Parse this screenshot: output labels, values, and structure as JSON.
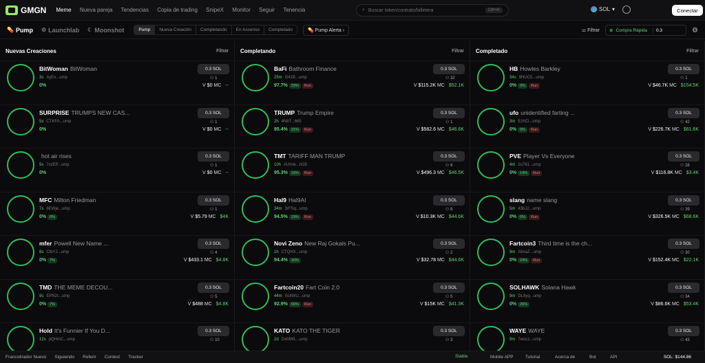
{
  "header": {
    "logo": "GMGN",
    "nav": [
      "Meme",
      "Nueva pareja",
      "Tendencias",
      "Copia de trading",
      "SnipeX",
      "Monitor",
      "Seguir",
      "Tenencia"
    ],
    "search_placeholder": "Buscar token/contrato/billetera",
    "search_kbd": "Ctrl+K",
    "chain": "SOL",
    "connect": "Conectar"
  },
  "subbar": {
    "tabs": [
      "Pump",
      "Launchlab",
      "Moonshot"
    ],
    "segments": [
      "Pump",
      "Nueva Creación",
      "Completando",
      "En Ascenso",
      "Completado"
    ],
    "pump_alert": "Pump Alerta",
    "filtrar": "Filtrar",
    "quick_buy": "Compra Rápida",
    "quick_val": "0.3"
  },
  "columns": [
    {
      "title": "Nuevas Creaciones",
      "filter": "Filtrar",
      "items": [
        {
          "sym": "BitWoman",
          "name": "BitWoman",
          "age": "3s",
          "addr": "AyEx...ump",
          "h1": "1",
          "pct": "0%",
          "v": "$0",
          "mc": "--"
        },
        {
          "sym": "SURPRISE",
          "name": "TRUMPS NEW CAS...",
          "age": "5s",
          "addr": "CTKFA...ump",
          "h1": "1",
          "pct": "0%",
          "v": "$0",
          "mc": "--"
        },
        {
          "sym": "",
          "name": "hot air rises",
          "age": "5s",
          "addr": "7vzEP...ump",
          "h1": "1",
          "pct": "0%",
          "v": "$0",
          "mc": "--"
        },
        {
          "sym": "MFC",
          "name": "Milton Friedman",
          "age": "7s",
          "addr": "6EWje...ump",
          "h1": "1",
          "pct": "0%",
          "badge": "0%",
          "v": "$5.79",
          "mc": "$4K"
        },
        {
          "sym": "mfer",
          "name": "Powell New Name ...",
          "age": "8s",
          "addr": "CtbYJ...ump",
          "h1": "4",
          "pct": "0%",
          "badge": "7%",
          "v": "$433.1",
          "mc": "$4.8K"
        },
        {
          "sym": "TMD",
          "name": "THE MEME DECOU...",
          "age": "9s",
          "addr": "EPN2t...ump",
          "h1": "5",
          "pct": "0%",
          "badge": "7%",
          "v": "$488",
          "mc": "$4.8K"
        },
        {
          "sym": "Hold",
          "name": "It's Funnier If You D...",
          "age": "12s",
          "addr": "pQHmC...ump",
          "h1": "10",
          "pct": "",
          "v": "",
          "mc": ""
        }
      ]
    },
    {
      "title": "Completando",
      "filter": "Filtrar",
      "items": [
        {
          "sym": "BaFi",
          "name": "Bathroom Finance",
          "age": "25m",
          "addr": "G41B...ump",
          "h1": "32",
          "pct": "97.7%",
          "badge": "33%",
          "run": "Run",
          "v": "$115.2K",
          "mc": "$52.1K"
        },
        {
          "sym": "TRUMP",
          "name": "Trump Empire",
          "age": "2h",
          "addr": "4NbT...665",
          "h1": "1",
          "pct": "95.4%",
          "badge": "21%",
          "run": "Run",
          "v": "$582.6",
          "mc": "$46.6K"
        },
        {
          "sym": "TMT",
          "name": "TARIFF MAN TRUMP",
          "age": "10h",
          "addr": "AUhnk...N35",
          "h1": "6",
          "pct": "95.3%",
          "badge": "19%",
          "run": "Run",
          "v": "$496.3",
          "mc": "$46.5K"
        },
        {
          "sym": "Hal9",
          "name": "Hal9AI",
          "age": "34m",
          "addr": "3rFSq...ump",
          "h1": "8",
          "pct": "94.5%",
          "badge": "19%",
          "run": "Run",
          "v": "$10.3K",
          "mc": "$44.6K"
        },
        {
          "sym": "Novi Zeno",
          "name": "New Raj Gokals Pu...",
          "age": "1h",
          "addr": "CTQHX...ump",
          "h1": "2",
          "pct": "94.4%",
          "badge": "16%",
          "v": "$32.78",
          "mc": "$44.6K"
        },
        {
          "sym": "Fartcoin20",
          "name": "Fart Coin 2.0",
          "age": "44m",
          "addr": "SUtWU...ump",
          "h1": "5",
          "pct": "92.9%",
          "badge": "66%",
          "run": "Run",
          "v": "$15K",
          "mc": "$41.3K"
        },
        {
          "sym": "KATO",
          "name": "KATO THE TIGER",
          "age": "2d",
          "addr": "DxMWL...ump",
          "h1": "3",
          "pct": "",
          "v": "",
          "mc": ""
        }
      ]
    },
    {
      "title": "Completado",
      "filter": "Filtrar",
      "items": [
        {
          "sym": "HB",
          "name": "Howles Barkley",
          "age": "34s",
          "addr": "9NUC5...ump",
          "h1": "1",
          "pct": "0%",
          "badge": "0%",
          "run": "Run",
          "v": "$46.7K",
          "mc": "$154.5K"
        },
        {
          "sym": "ufo",
          "name": "unidentified farting ...",
          "age": "3m",
          "addr": "EzhCi...ump",
          "h1": "42",
          "pct": "0%",
          "badge": "0%",
          "run": "Run",
          "v": "$226.7K",
          "mc": "$61.6K"
        },
        {
          "sym": "PVE",
          "name": "Player Vs Everyone",
          "age": "4m",
          "addr": "2o761...ump",
          "h1": "28",
          "pct": "0%",
          "badge": "14%",
          "run": "Run",
          "v": "$116.8K",
          "mc": "$3.4K"
        },
        {
          "sym": "slang",
          "name": "name slang",
          "age": "5m",
          "addr": "43bJ2...ump",
          "h1": "39",
          "pct": "0%",
          "badge": "0%",
          "run": "Run",
          "v": "$326.5K",
          "mc": "$68.6K"
        },
        {
          "sym": "Fartcoin3",
          "name": "Third time is the ch...",
          "age": "9m",
          "addr": "AbsaZ...ump",
          "h1": "30",
          "pct": "0%",
          "badge": "24%",
          "run": "Run",
          "v": "$152.4K",
          "mc": "$22.1K"
        },
        {
          "sym": "SOLHAWK",
          "name": "Solana Hawk",
          "age": "9m",
          "addr": "DL8yq...ump",
          "h1": "34",
          "pct": "0%",
          "badge": "26%",
          "v": "$86.6K",
          "mc": "$53.4K"
        },
        {
          "sym": "WAYE",
          "name": "WAYE",
          "age": "9m",
          "addr": "7wocz...ump",
          "h1": "43",
          "pct": "",
          "v": "",
          "mc": ""
        }
      ]
    }
  ],
  "buy_label": "0.3 SOL",
  "footer": {
    "items": [
      "Francotirador Nuevo",
      "Siguiendo",
      "Referir",
      "Contest",
      "Tracker"
    ],
    "stable": "Stable",
    "right": [
      "Mobile APP",
      "Tutorial",
      "Acerca de",
      "Bot",
      "API"
    ],
    "sol": "SOL: $144.86"
  }
}
